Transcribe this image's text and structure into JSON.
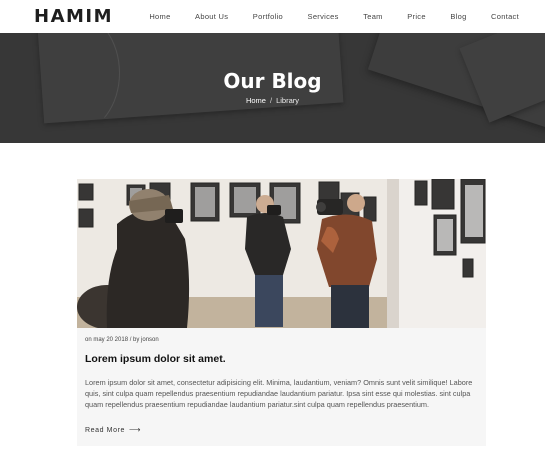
{
  "header": {
    "logo": "HAMIM",
    "nav": [
      "Home",
      "About Us",
      "Portfolio",
      "Services",
      "Team",
      "Price",
      "Blog",
      "Contact"
    ]
  },
  "hero": {
    "title": "Our Blog",
    "breadcrumb": {
      "home": "Home",
      "separator": "/",
      "current": "Library"
    }
  },
  "post": {
    "image_alt": "photographers in a gallery",
    "meta": "on may 20 2018 / by jonson",
    "title": "Lorem ipsum dolor sit amet.",
    "excerpt": "Lorem ipsum dolor sit amet, consectetur adipisicing elit. Minima, laudantium, veniam? Omnis sunt velit similique! Labore quis, sint culpa quam repellendus praesentium repudiandae laudantium pariatur. Ipsa sint esse qui molestias. sint culpa quam repellendus praesentium repudiandae laudantium pariatur.sint culpa quam repellendus praesentium.",
    "read_more": "Read More",
    "read_more_icon": "arrow-right-icon"
  }
}
